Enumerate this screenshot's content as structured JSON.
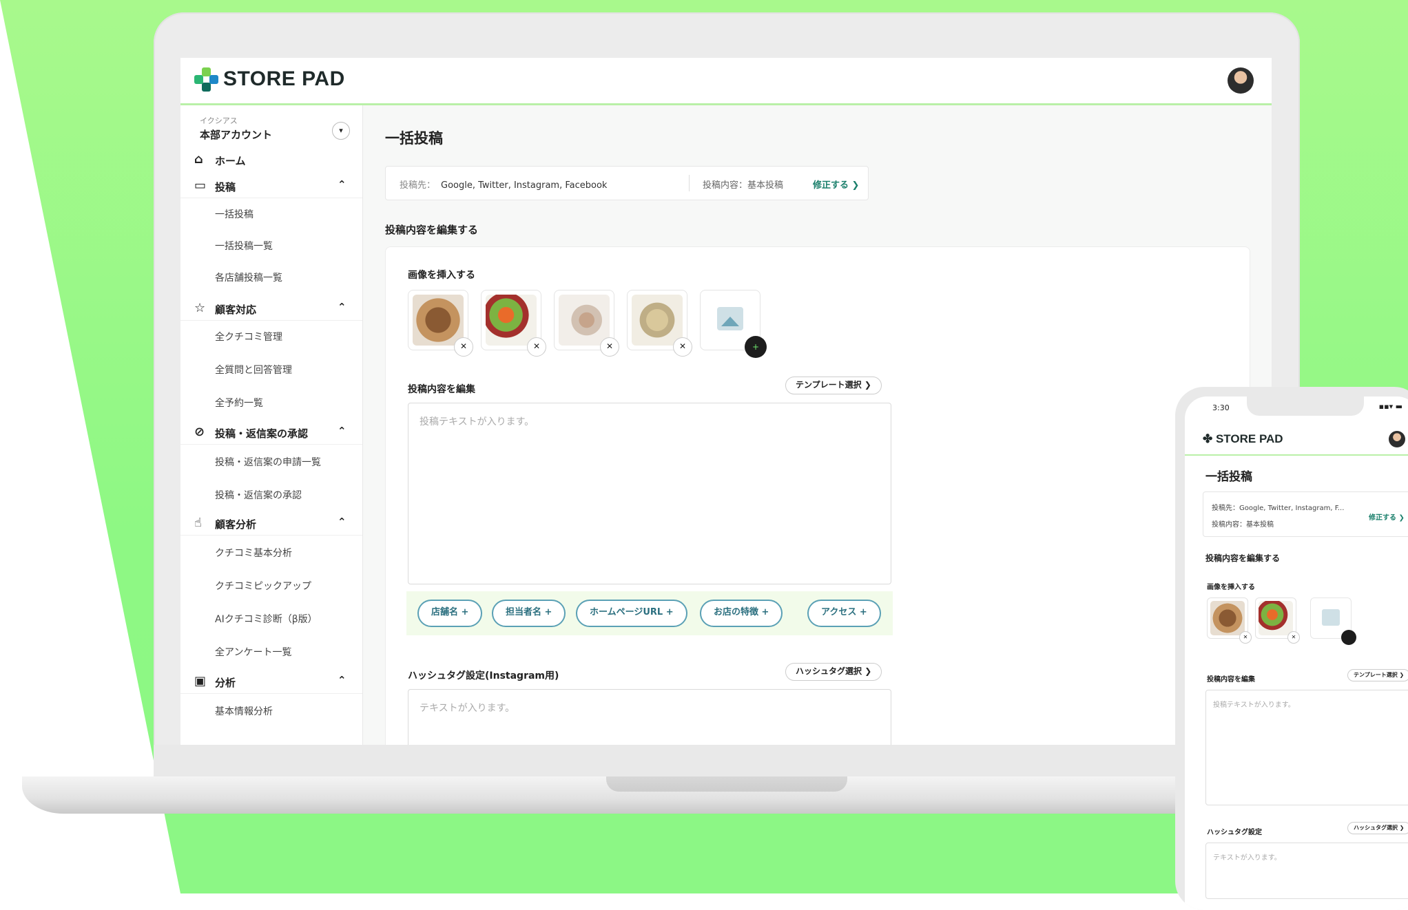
{
  "app": {
    "brand": "STORE PAD",
    "brand_colors": [
      "#2bb673",
      "#1e88c8",
      "#7bd14f",
      "#0e6b5c"
    ]
  },
  "sidebar": {
    "account_small": "イクシアス",
    "account_name": "本部アカウント",
    "sections": [
      {
        "icon": "home-icon",
        "label": "ホーム",
        "expandable": false,
        "items": []
      },
      {
        "icon": "post-icon",
        "label": "投稿",
        "expandable": true,
        "items": [
          "一括投稿",
          "一括投稿一覧",
          "各店舗投稿一覧"
        ]
      },
      {
        "icon": "star-icon",
        "label": "顧客対応",
        "expandable": true,
        "items": [
          "全クチコミ管理",
          "全質問と回答管理",
          "全予約一覧"
        ]
      },
      {
        "icon": "check-icon",
        "label": "投稿・返信案の承認",
        "expandable": true,
        "items": [
          "投稿・返信案の申請一覧",
          "投稿・返信案の承認"
        ]
      },
      {
        "icon": "thumbs-up-icon",
        "label": "顧客分析",
        "expandable": true,
        "items": [
          "クチコミ基本分析",
          "クチコミピックアップ",
          "AIクチコミ診断（β版）",
          "全アンケート一覧"
        ]
      },
      {
        "icon": "chart-icon",
        "label": "分析",
        "expandable": true,
        "items": [
          "基本情報分析"
        ]
      }
    ]
  },
  "main": {
    "title": "一括投稿",
    "destinations_label": "投稿先：",
    "destinations": "Google, Twitter, Instagram, Facebook",
    "content_type": "投稿内容：基本投稿",
    "change": "修正する",
    "edit_heading": "投稿内容を編集する",
    "insert_image": "画像を挿入する",
    "edit_content": "投稿内容を編集",
    "template_button": "テンプレート選択",
    "textarea_placeholder": "投稿テキストが入ります。",
    "chips": [
      "店舗名",
      "担当者名",
      "ホームページURL",
      "お店の特徴",
      "アクセス"
    ],
    "hashtag_label": "ハッシュタグ設定(Instagram用)",
    "hashtag_button": "ハッシュタグ選択",
    "hashtag_placeholder": "テキストが入ります。"
  },
  "phone": {
    "time": "3:30",
    "status": "▪▪▾ ▬",
    "brand": "STORE PAD",
    "title": "一括投稿",
    "dest_line1": "投稿先：Google, Twitter, Instagram, F...",
    "dest_line2": "投稿内容：基本投稿",
    "change": "修正する",
    "edit_heading": "投稿内容を編集する",
    "insert_image": "画像を挿入する",
    "edit_content": "投稿内容を編集",
    "template_button": "テンプレート選択",
    "textarea_placeholder": "投稿テキストが入ります。",
    "hashtag_label": "ハッシュタグ設定",
    "hashtag_button": "ハッシュタグ選択",
    "hashtag_placeholder": "テキストが入ります。"
  }
}
